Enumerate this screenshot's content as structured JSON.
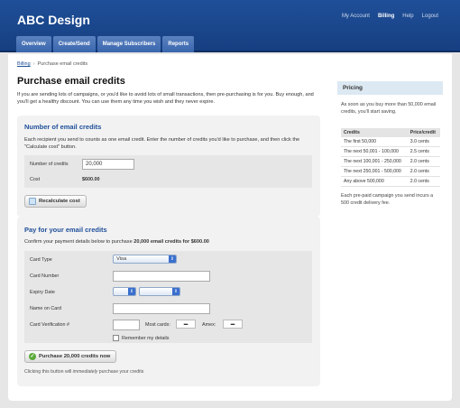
{
  "app": {
    "logo": "ABC Design"
  },
  "topnav": [
    "My Account",
    "Billing",
    "Help",
    "Logout"
  ],
  "tabs": [
    "Overview",
    "Create/Send",
    "Manage Subscribers",
    "Reports"
  ],
  "breadcrumb": {
    "parent": "Billing",
    "current": "Purchase email credits"
  },
  "page": {
    "title": "Purchase email credits",
    "intro": "If you are sending lots of campaigns, or you'd like to avoid lots of small transactions, then pre-purchasing is for you. Buy enough, and you'll get a healthy discount. You can use them any time you wish and they never expire."
  },
  "credits": {
    "heading": "Number of email credits",
    "text": "Each recipient you send to counts as one email credit. Enter the number of credits you'd like to purchase, and then click the \"Calculate cost\" button.",
    "number_label": "Number of credits",
    "number_value": "20,000",
    "cost_label": "Cost",
    "cost_value": "$600.00",
    "recalc_button": "Recalculate cost"
  },
  "payment": {
    "heading": "Pay for your email credits",
    "confirm_prefix": "Confirm your payment details below to purchase ",
    "confirm_bold": "20,000 email credits for $600.00",
    "card_type_label": "Card Type",
    "card_type_value": "Visa",
    "card_number_label": "Card Number",
    "expiry_label": "Expiry Date",
    "name_label": "Name on Card",
    "cvv_label": "Card Verification #",
    "most_cards_label": "Most cards:",
    "amex_label": "Amex:",
    "remember_label": "Remember my details",
    "purchase_button": "Purchase 20,000 credits now",
    "footnote_prefix": "Clicking this button will ",
    "footnote_em": "immediately",
    "footnote_suffix": " purchase your credits"
  },
  "sidebar": {
    "heading": "Pricing",
    "intro": "As soon as you buy more than 50,000 email credits, you'll start saving.",
    "columns": [
      "Credits",
      "Price/credit"
    ],
    "rows": [
      [
        "The first 50,000",
        "3.0 cents"
      ],
      [
        "The next 50,001 - 100,000",
        "2.5 cents"
      ],
      [
        "The next 100,001 - 250,000",
        "2.0 cents"
      ],
      [
        "The next 250,001 - 500,000",
        "2.0 cents"
      ],
      [
        "Any above 500,000",
        "2.0 cents"
      ]
    ],
    "note": "Each pre-paid campaign you send incurs a 500 credit delivery fee."
  }
}
